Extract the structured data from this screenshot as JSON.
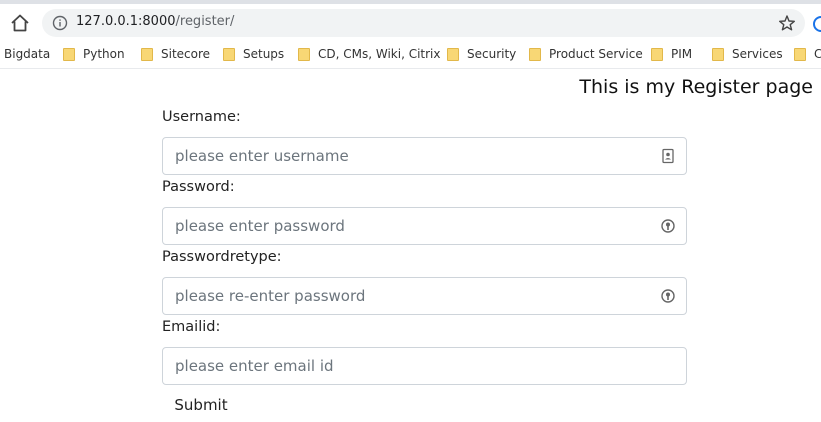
{
  "browser": {
    "url_host": "127.0.0.1:8000",
    "url_path": "/register/",
    "bookmarks": [
      {
        "label": "Bigdata",
        "folder": false
      },
      {
        "label": "Python",
        "folder": true
      },
      {
        "label": "Sitecore",
        "folder": true
      },
      {
        "label": "Setups",
        "folder": true
      },
      {
        "label": "CD, CMs, Wiki, Citrix",
        "folder": true
      },
      {
        "label": "Security",
        "folder": true
      },
      {
        "label": "Product Service",
        "folder": true
      },
      {
        "label": "PIM",
        "folder": true
      },
      {
        "label": "Services",
        "folder": true
      },
      {
        "label": "C",
        "folder": true
      }
    ]
  },
  "page": {
    "heading": "This is my Register page"
  },
  "form": {
    "username": {
      "label": "Username:",
      "placeholder": "please enter username",
      "value": ""
    },
    "password": {
      "label": "Password:",
      "placeholder": "please enter password",
      "value": ""
    },
    "password_retype": {
      "label": "Passwordretype:",
      "placeholder": "please re-enter password",
      "value": ""
    },
    "email": {
      "label": "Emailid:",
      "placeholder": "please enter email id",
      "value": ""
    },
    "submit_label": "Submit"
  },
  "colors": {
    "folder": "#f8d775",
    "url_bar": "#f1f3f4",
    "input_border": "#ced4da"
  }
}
